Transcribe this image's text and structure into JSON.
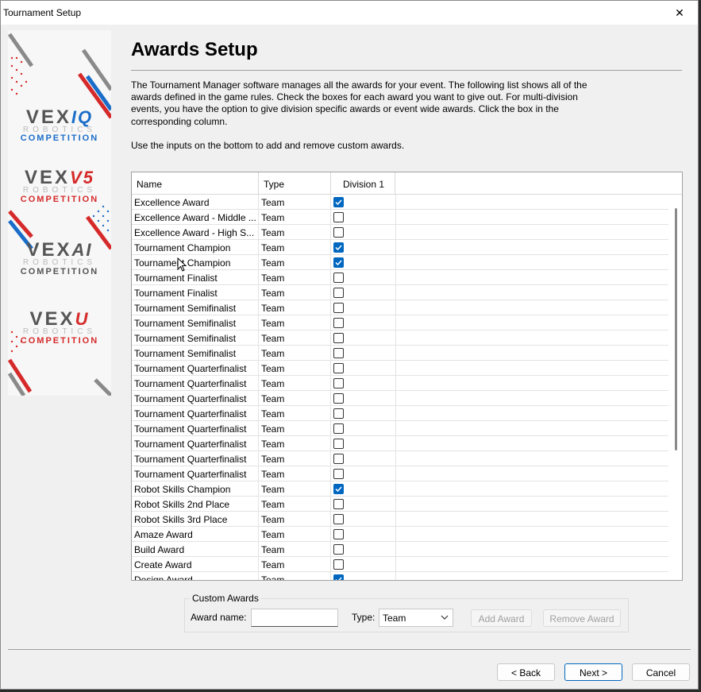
{
  "window": {
    "title": "Tournament Setup",
    "close_glyph": "✕"
  },
  "logos": [
    {
      "brand": "VEX",
      "series": "IQ",
      "line1": "ROBOTICS",
      "line2": "COMPETITION",
      "color": "#1a6dc8"
    },
    {
      "brand": "VEX",
      "series": "V5",
      "line1": "ROBOTICS",
      "line2": "COMPETITION",
      "color": "#d62a2a"
    },
    {
      "brand": "VEX",
      "series": "AI",
      "line1": "ROBOTICS",
      "line2": "COMPETITION",
      "color": "#555555"
    },
    {
      "brand": "VEX",
      "series": "U",
      "line1": "ROBOTICS",
      "line2": "COMPETITION",
      "color": "#d62a2a"
    }
  ],
  "header": {
    "title": "Awards Setup",
    "description": "The Tournament Manager software manages all the awards for your event.  The following list shows all of the awards defined in the game rules.  Check the boxes for each award you want to give out.  For multi-division events, you have the option to give division specific awards or event wide awards.  Click the box in the corresponding column.",
    "instructions": "Use the inputs on the bottom to add and remove custom awards."
  },
  "grid": {
    "columns": [
      "Name",
      "Type",
      "Division 1"
    ],
    "rows": [
      {
        "name": "Excellence Award",
        "type": "Team",
        "division1": true
      },
      {
        "name": "Excellence Award - Middle ...",
        "type": "Team",
        "division1": false
      },
      {
        "name": "Excellence Award - High S...",
        "type": "Team",
        "division1": false
      },
      {
        "name": "Tournament Champion",
        "type": "Team",
        "division1": true
      },
      {
        "name": "Tournament Champion",
        "type": "Team",
        "division1": true
      },
      {
        "name": "Tournament Finalist",
        "type": "Team",
        "division1": false
      },
      {
        "name": "Tournament Finalist",
        "type": "Team",
        "division1": false
      },
      {
        "name": "Tournament Semifinalist",
        "type": "Team",
        "division1": false
      },
      {
        "name": "Tournament Semifinalist",
        "type": "Team",
        "division1": false
      },
      {
        "name": "Tournament Semifinalist",
        "type": "Team",
        "division1": false
      },
      {
        "name": "Tournament Semifinalist",
        "type": "Team",
        "division1": false
      },
      {
        "name": "Tournament Quarterfinalist",
        "type": "Team",
        "division1": false
      },
      {
        "name": "Tournament Quarterfinalist",
        "type": "Team",
        "division1": false
      },
      {
        "name": "Tournament Quarterfinalist",
        "type": "Team",
        "division1": false
      },
      {
        "name": "Tournament Quarterfinalist",
        "type": "Team",
        "division1": false
      },
      {
        "name": "Tournament Quarterfinalist",
        "type": "Team",
        "division1": false
      },
      {
        "name": "Tournament Quarterfinalist",
        "type": "Team",
        "division1": false
      },
      {
        "name": "Tournament Quarterfinalist",
        "type": "Team",
        "division1": false
      },
      {
        "name": "Tournament Quarterfinalist",
        "type": "Team",
        "division1": false
      },
      {
        "name": "Robot Skills Champion",
        "type": "Team",
        "division1": true
      },
      {
        "name": "Robot Skills 2nd Place",
        "type": "Team",
        "division1": false
      },
      {
        "name": "Robot Skills 3rd Place",
        "type": "Team",
        "division1": false
      },
      {
        "name": "Amaze Award",
        "type": "Team",
        "division1": false
      },
      {
        "name": "Build Award",
        "type": "Team",
        "division1": false
      },
      {
        "name": "Create Award",
        "type": "Team",
        "division1": false
      },
      {
        "name": "Design Award",
        "type": "Team",
        "division1": true
      }
    ]
  },
  "custom_awards": {
    "group_title": "Custom Awards",
    "name_label": "Award name:",
    "name_value": "",
    "type_label": "Type:",
    "type_value": "Team",
    "add_label": "Add Award",
    "remove_label": "Remove Award"
  },
  "footer": {
    "back_label": "< Back",
    "next_label": "Next >",
    "cancel_label": "Cancel"
  },
  "colors": {
    "accent": "#0067c0",
    "red": "#d62a2a",
    "blue": "#1a6dc8",
    "gray": "#8a8a8a"
  }
}
